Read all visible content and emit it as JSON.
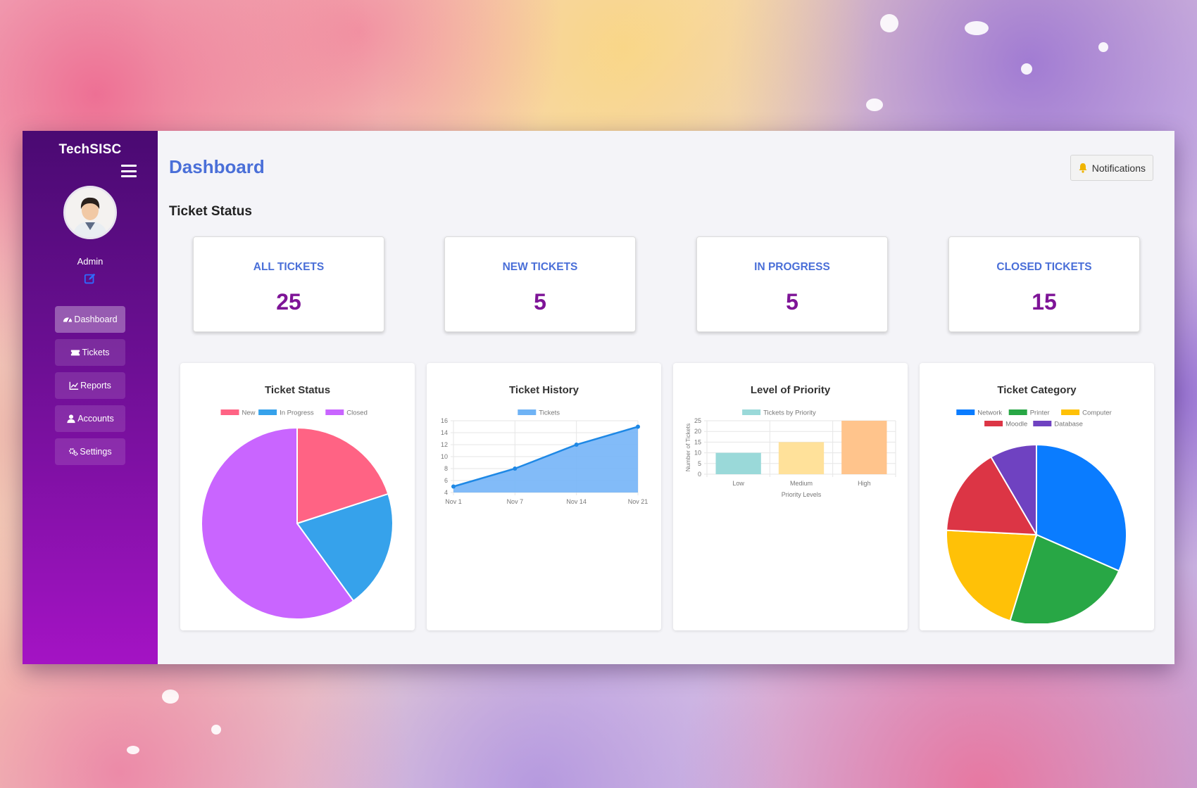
{
  "app": {
    "brand": "TechSISC"
  },
  "colors": {
    "sidebar_top": "#4a0a72",
    "sidebar_bottom": "#a413c4",
    "title_blue": "#4a6fd8",
    "stat_purple": "#7e1497"
  },
  "profile": {
    "name": "Admin",
    "avatar_icon": "user-avatar",
    "edit_icon": "edit-icon"
  },
  "sidebar": {
    "items": [
      {
        "label": "Dashboard",
        "icon": "gauge-icon",
        "active": true
      },
      {
        "label": "Tickets",
        "icon": "ticket-icon",
        "active": false
      },
      {
        "label": "Reports",
        "icon": "chart-line-icon",
        "active": false
      },
      {
        "label": "Accounts",
        "icon": "user-icon",
        "active": false
      },
      {
        "label": "Settings",
        "icon": "gears-icon",
        "active": false
      }
    ]
  },
  "header": {
    "title": "Dashboard",
    "notifications_label": "Notifications",
    "notifications_icon": "bell-icon"
  },
  "section": {
    "title": "Ticket Status"
  },
  "stats": [
    {
      "label": "ALL TICKETS",
      "value": "25"
    },
    {
      "label": "NEW TICKETS",
      "value": "5"
    },
    {
      "label": "IN PROGRESS",
      "value": "5"
    },
    {
      "label": "CLOSED TICKETS",
      "value": "15"
    }
  ],
  "chart_data": [
    {
      "type": "pie",
      "title": "Ticket Status",
      "categories": [
        "New",
        "In Progress",
        "Closed"
      ],
      "values": [
        5,
        5,
        15
      ],
      "colors": [
        "#ff6384",
        "#36a2eb",
        "#c965ff"
      ],
      "legend": "top"
    },
    {
      "type": "area",
      "title": "Ticket History",
      "categories": [
        "Nov 1",
        "Nov 7",
        "Nov 14",
        "Nov 21"
      ],
      "series": [
        {
          "name": "Tickets",
          "values": [
            5,
            8,
            12,
            15
          ]
        }
      ],
      "ylim": [
        4,
        16
      ],
      "yticks": [
        4,
        6,
        8,
        10,
        12,
        14,
        16
      ],
      "colors": [
        "#1e88e5"
      ],
      "legend": "top",
      "grid": true
    },
    {
      "type": "bar",
      "title": "Level of Priority",
      "categories": [
        "Low",
        "Medium",
        "High"
      ],
      "series": [
        {
          "name": "Tickets by Priority",
          "values": [
            10,
            15,
            25
          ]
        }
      ],
      "xlabel": "Priority Levels",
      "ylabel": "Number of Tickets",
      "ylim": [
        0,
        25
      ],
      "yticks": [
        0,
        5,
        10,
        15,
        20,
        25
      ],
      "colors": [
        "#9ad9d9",
        "#ffe19a",
        "#ffc48c"
      ],
      "legend": "top",
      "grid": true
    },
    {
      "type": "pie",
      "title": "Ticket Category",
      "categories": [
        "Network",
        "Printer",
        "Computer",
        "Moodle",
        "Database"
      ],
      "values": [
        30,
        22,
        20,
        15,
        8
      ],
      "colors": [
        "#0a7cff",
        "#28a745",
        "#ffc107",
        "#dc3545",
        "#6f42c1"
      ],
      "legend": "top"
    }
  ]
}
